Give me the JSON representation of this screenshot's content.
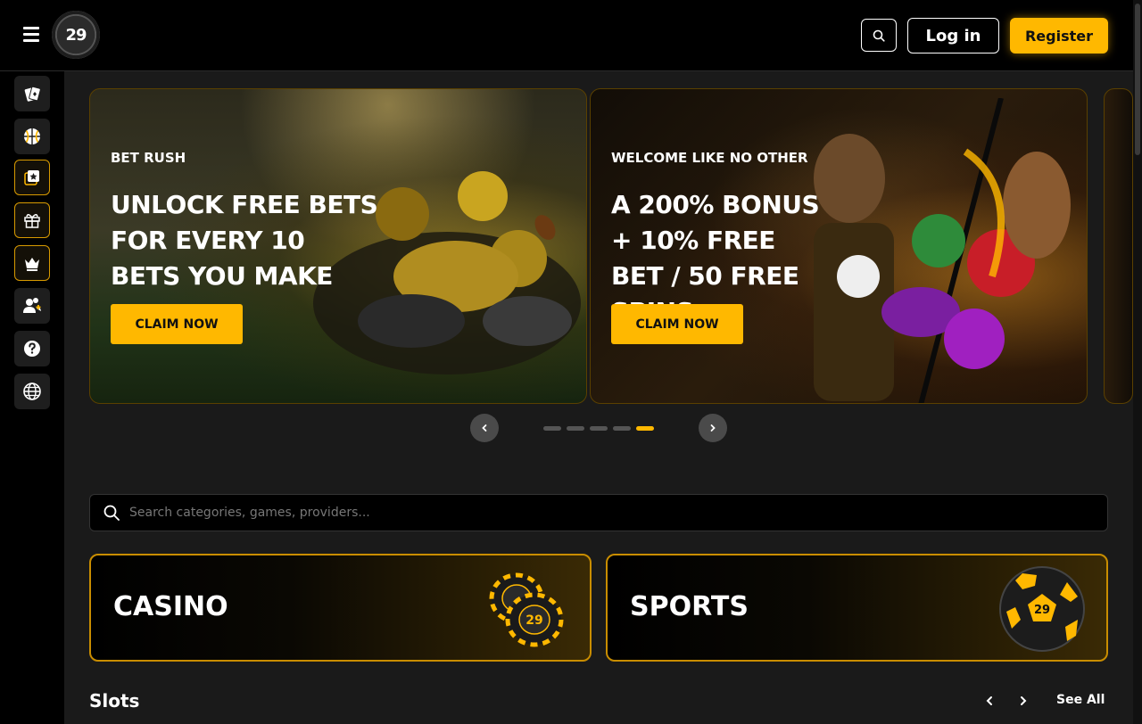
{
  "header": {
    "logo_text": "29",
    "login_label": "Log in",
    "register_label": "Register",
    "accent_color": "#ffb800"
  },
  "sidebar": {
    "items": [
      {
        "icon": "cards-icon"
      },
      {
        "icon": "basketball-icon"
      },
      {
        "icon": "star-cards-icon"
      },
      {
        "icon": "gift-icon"
      },
      {
        "icon": "crown-icon"
      },
      {
        "icon": "refer-friend-icon"
      },
      {
        "icon": "help-icon"
      },
      {
        "icon": "globe-icon"
      }
    ]
  },
  "banners": [
    {
      "eyebrow": "BET RUSH",
      "title": "UNLOCK FREE BETS FOR EVERY 10 BETS YOU MAKE",
      "cta": "CLAIM NOW"
    },
    {
      "eyebrow": "WELCOME LIKE NO OTHER",
      "title": "A 200% BONUS + 10% FREE BET / 50 FREE SPINS",
      "cta": "CLAIM NOW"
    }
  ],
  "carousel": {
    "dot_count": 5,
    "active_dot": 5
  },
  "search": {
    "placeholder": "Search categories, games, providers..."
  },
  "categories": [
    {
      "label": "CASINO"
    },
    {
      "label": "SPORTS"
    }
  ],
  "slots": {
    "title": "Slots",
    "see_all_label": "See All"
  }
}
